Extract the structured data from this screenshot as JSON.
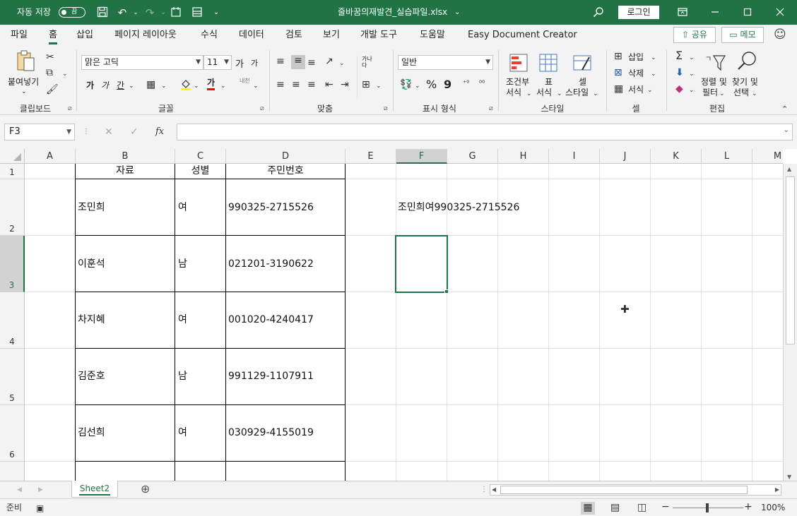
{
  "titlebar": {
    "autosave_label": "자동 저장",
    "autosave_toggle": "끔",
    "filename": "줄바꿈의재발견_실습파일.xlsx",
    "login_label": "로그인",
    "dropdown_glyph": "⌄"
  },
  "menu": {
    "tabs": [
      "파일",
      "홈",
      "삽입",
      "페이지 레이아웃",
      "수식",
      "데이터",
      "검토",
      "보기",
      "개발 도구",
      "도움말",
      "Easy Document Creator"
    ],
    "active": "홈",
    "share_label": "공유",
    "memo_label": "메모"
  },
  "ribbon": {
    "clipboard": {
      "label": "클립보드",
      "paste": "붙여넣기"
    },
    "font": {
      "label": "글꼴",
      "font_name": "맑은 고딕",
      "font_size": "11",
      "grow": "가",
      "shrink": "가",
      "bold": "가",
      "italic": "가",
      "underline": "간",
      "color_a": "가",
      "phonetic": "내천"
    },
    "align": {
      "label": "맞춤",
      "wrap": "가나다"
    },
    "number": {
      "label": "표시 형식",
      "format": "일반",
      "percent": "%",
      "comma": "9"
    },
    "styles": {
      "label": "스타일",
      "conditional_1": "조건부",
      "conditional_2": "서식",
      "table_1": "표",
      "table_2": "서식",
      "cell_1": "셀",
      "cell_2": "스타일"
    },
    "cells": {
      "label": "셀",
      "insert": "삽입",
      "delete": "삭제",
      "format": "서식"
    },
    "editing": {
      "label": "편집",
      "sort_1": "정렬 및",
      "sort_2": "필터",
      "find_1": "찾기 및",
      "find_2": "선택"
    }
  },
  "formula_bar": {
    "name_box": "F3",
    "fx": "fx",
    "value": ""
  },
  "grid": {
    "columns": [
      "A",
      "B",
      "C",
      "D",
      "E",
      "F",
      "G",
      "H",
      "I",
      "J",
      "K",
      "L",
      "M"
    ],
    "rows": [
      "1",
      "2",
      "3",
      "4",
      "5",
      "6"
    ],
    "selected_col": "F",
    "selected_row": "3",
    "header_row": [
      "자료",
      "성별",
      "주민번호"
    ],
    "records": [
      {
        "name": "조민희",
        "gender": "여",
        "id": "990325-2715526"
      },
      {
        "name": "이훈석",
        "gender": "남",
        "id": "021201-3190622"
      },
      {
        "name": "차지혜",
        "gender": "여",
        "id": "001020-4240417"
      },
      {
        "name": "김준호",
        "gender": "남",
        "id": "991129-1107911"
      },
      {
        "name": "김선희",
        "gender": "여",
        "id": "030929-4155019"
      }
    ],
    "f2_value": "조민희여990325-2715526"
  },
  "sheets": {
    "tabs": [
      "Sheet2"
    ]
  },
  "status": {
    "ready": "준비",
    "zoom": "100%"
  }
}
